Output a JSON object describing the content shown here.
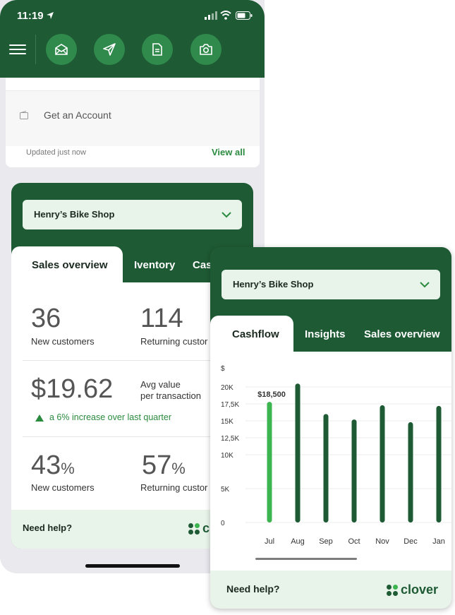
{
  "status_bar": {
    "time": "11:19"
  },
  "header": {
    "buttons": [
      {
        "icon": "mail-dollar-icon"
      },
      {
        "icon": "send-icon"
      },
      {
        "icon": "document-icon"
      },
      {
        "icon": "camera-icon"
      }
    ]
  },
  "account_card": {
    "item_label": "Get an Account",
    "updated_text": "Updated just now",
    "view_all": "View all"
  },
  "sales_card": {
    "shop_name": "Henry’s Bike Shop",
    "tabs": [
      "Sales overview",
      "Iventory",
      "Cas"
    ],
    "metrics": {
      "new_customers_value": "36",
      "new_customers_label": "New customers",
      "returning_value": "114",
      "returning_label": "Returning custor",
      "avg_value": "$19.62",
      "avg_label_line1": "Avg value",
      "avg_label_line2": "per transaction",
      "increase_text": "a 6% increase over last quarter",
      "new_pct_value": "43",
      "new_pct_unit": "%",
      "new_pct_label": "New customers",
      "returning_pct_value": "57",
      "returning_pct_unit": "%",
      "returning_pct_label": "Returning custor"
    },
    "help_text": "Need help?",
    "logo_text": "cl"
  },
  "cashflow_card": {
    "shop_name": "Henry’s Bike Shop",
    "tabs": [
      "Cashflow",
      "Insights",
      "Sales overview"
    ],
    "help_text": "Need help?",
    "logo_text": "clover"
  },
  "chart_data": {
    "type": "bar",
    "ylabel": "$",
    "ylim": [
      0,
      20000
    ],
    "y_ticks": [
      "0",
      "5K",
      "10K",
      "12,5K",
      "15K",
      "17,5K",
      "20K"
    ],
    "categories": [
      "Jul",
      "Aug",
      "Sep",
      "Oct",
      "Nov",
      "Dec",
      "Jan"
    ],
    "values": [
      17800,
      20500,
      16000,
      15200,
      17300,
      14800,
      17200
    ],
    "highlight": {
      "category": "Jul",
      "label": "$18,500"
    },
    "colors": {
      "highlight": "#3cb44f",
      "bar": "#1e5a34"
    }
  }
}
